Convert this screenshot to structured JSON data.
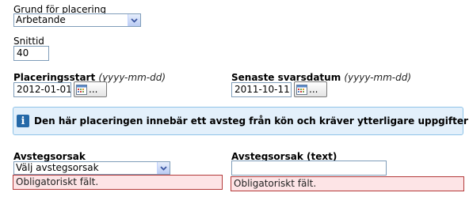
{
  "placement_reason": {
    "label": "Grund för placering",
    "selected": "Arbetande"
  },
  "average_time": {
    "label": "Snittid",
    "value": "40"
  },
  "placement_start": {
    "label": "Placeringsstart",
    "format_hint": "(yyyy-mm-dd)",
    "value": "2012-01-01",
    "picker_label": "..."
  },
  "last_reply_date": {
    "label": "Senaste svarsdatum",
    "format_hint": "(yyyy-mm-dd)",
    "value": "2011-10-11",
    "picker_label": "..."
  },
  "info_message": {
    "icon": "info-icon",
    "text": "Den här placeringen innebär ett avsteg från kön och kräver ytterligare uppgifter!"
  },
  "deviation_reason": {
    "label": "Avstegsorsak",
    "selected": "Välj avstegsorsak",
    "error": "Obligatoriskt fält."
  },
  "deviation_reason_text": {
    "label": "Avstegsorsak (text)",
    "value": "",
    "error": "Obligatoriskt fält."
  },
  "colors": {
    "info_bg": "#e3f0fb",
    "info_border": "#8fc3e8",
    "error_bg": "#fde4e6",
    "error_border": "#b33a3a"
  }
}
